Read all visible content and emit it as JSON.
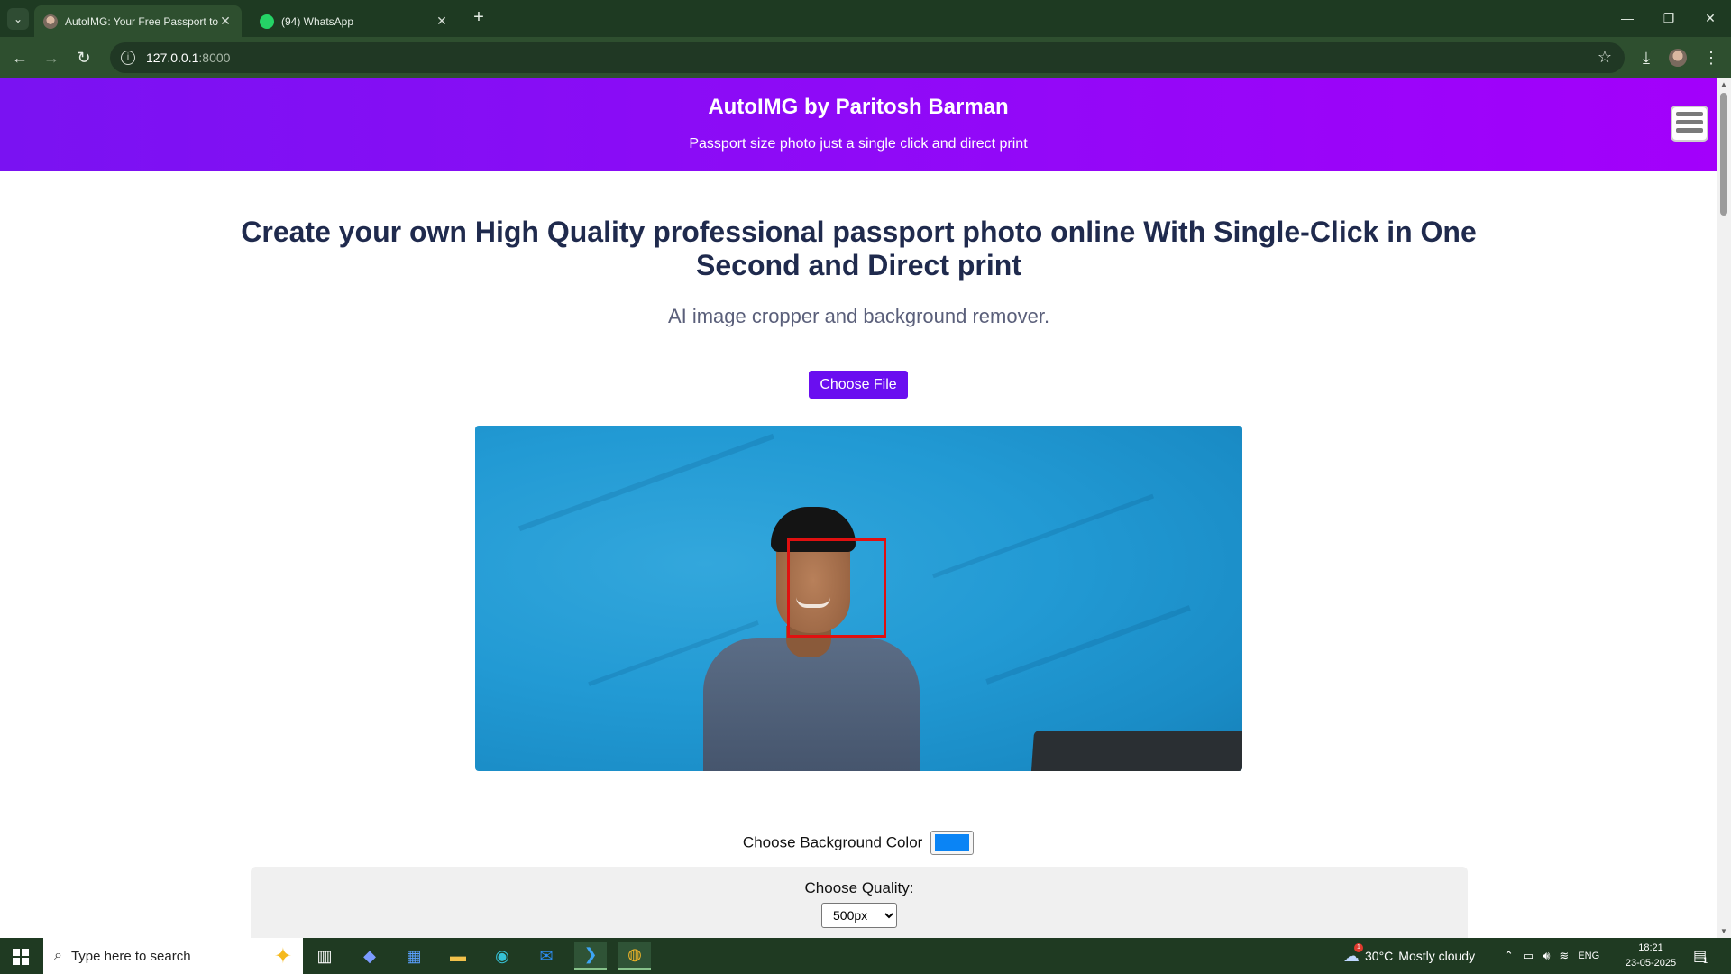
{
  "browser": {
    "tabs": [
      {
        "title": "AutoIMG: Your Free Passport to",
        "active": true
      },
      {
        "title": "(94) WhatsApp",
        "active": false
      }
    ],
    "url_host": "127.0.0.1",
    "url_port": ":8000"
  },
  "site": {
    "title": "AutoIMG by Paritosh Barman",
    "subtitle": "Passport size photo just a single click and direct print",
    "headline": "Create your own High Quality professional passport photo online With Single-Click in One Second and Direct print",
    "tagline": "AI image cropper and background remover.",
    "choose_file_label": "Choose File",
    "bg_color_label": "Choose Background Color",
    "bg_color_value": "#0a84f5",
    "quality_label": "Choose Quality:",
    "quality_selected": "500px",
    "brand_gradient": [
      "#7a12f2",
      "#a300fb"
    ]
  },
  "taskbar": {
    "search_placeholder": "Type here to search",
    "weather_temp": "30°C",
    "weather_text": "Mostly cloudy",
    "language": "ENG",
    "time": "18:21",
    "date": "23-05-2025",
    "notification_count": "1",
    "weather_badge": "1"
  }
}
